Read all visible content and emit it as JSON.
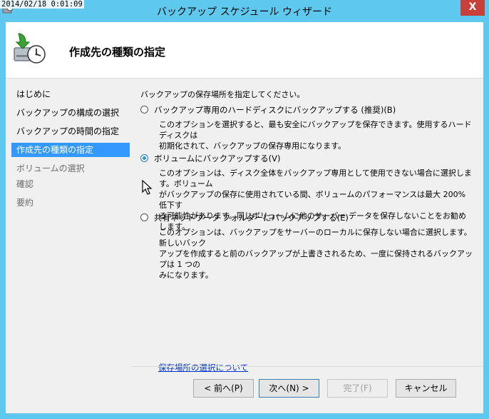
{
  "timestamp": "2014/02/18 0:01:09",
  "window": {
    "title": "バックアップ スケジュール ウィザード",
    "close_label": "X"
  },
  "header": {
    "page_title": "作成先の種類の指定"
  },
  "nav": {
    "items": [
      {
        "label": "はじめに",
        "state": "normal"
      },
      {
        "label": "バックアップの構成の選択",
        "state": "normal"
      },
      {
        "label": "バックアップの時間の指定",
        "state": "normal"
      },
      {
        "label": "作成先の種類の指定",
        "state": "active"
      },
      {
        "label": "ボリュームの選択",
        "state": "disabled"
      },
      {
        "label": "確認",
        "state": "disabled"
      },
      {
        "label": "要約",
        "state": "disabled"
      }
    ]
  },
  "content": {
    "instruction": "バックアップの保存場所を指定してください。",
    "options": [
      {
        "label": "バックアップ専用のハードディスクにバックアップする (推奨)(B)",
        "checked": false,
        "desc": [
          "このオプションを選択すると、最も安全にバックアップを保存できます。使用するハードディスクは",
          "初期化されて、バックアップの保存専用になります。"
        ]
      },
      {
        "label": "ボリュームにバックアップする(V)",
        "checked": true,
        "desc": [
          "このオプションは、ディスク全体をバックアップ専用として使用できない場合に選択します。ボリューム",
          "がバックアップの保存に使用されている間、ボリュームのパフォーマンスは最大 200% 低下す",
          "る可能性があります。同じボリュームに他のサーバー データを保存しないことをお勧めします。"
        ]
      },
      {
        "label": "共有ネットワーク フォルダーにバックアップする(E)",
        "checked": false,
        "desc": [
          "このオプションは、バックアップをサーバーのローカルに保存しない場合に選択します。新しいバック",
          "アップを作成すると前のバックアップが上書きされるため、一度に保持されるバックアップは 1 つの",
          "みになります。"
        ]
      }
    ],
    "help_link": "保存場所の選択について"
  },
  "buttons": {
    "back": "< 前へ(P)",
    "next": "次へ(N) >",
    "finish": "完了(F)",
    "cancel": "キャンセル"
  },
  "colors": {
    "titlebar": "#5ec8ee",
    "selection": "#3399ff",
    "link": "#0033cc",
    "close": "#c7413a"
  }
}
